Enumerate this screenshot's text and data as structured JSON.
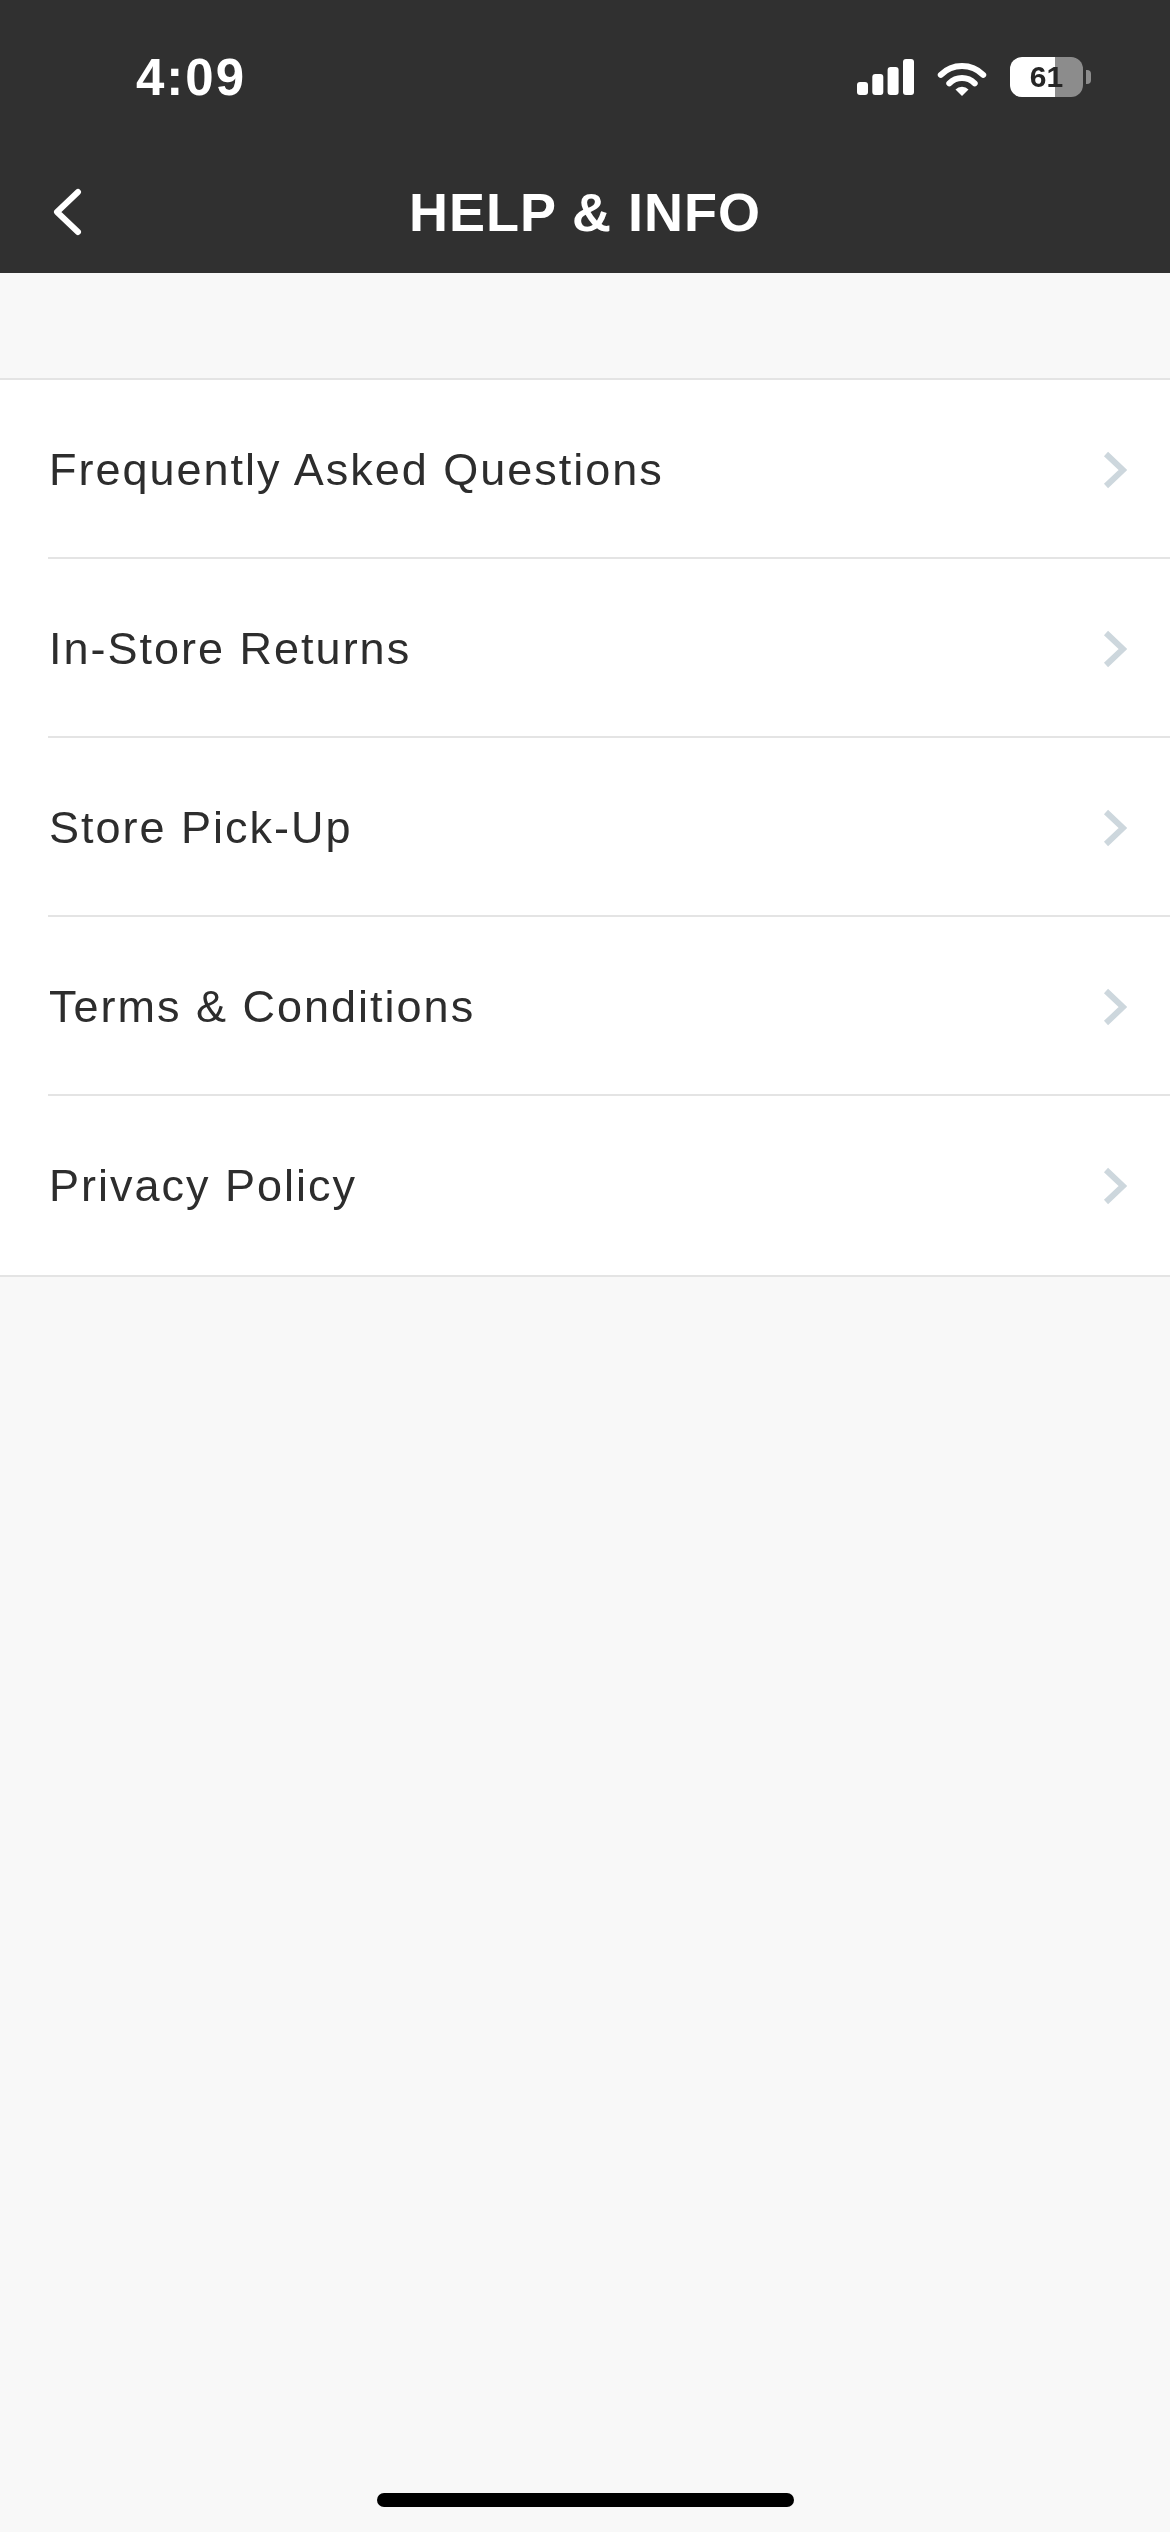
{
  "status_bar": {
    "time": "4:09",
    "battery": "61"
  },
  "header": {
    "title": "HELP & INFO"
  },
  "menu": [
    {
      "label": "Frequently Asked Questions"
    },
    {
      "label": "In-Store Returns"
    },
    {
      "label": "Store Pick-Up"
    },
    {
      "label": "Terms & Conditions"
    },
    {
      "label": "Privacy Policy"
    }
  ]
}
